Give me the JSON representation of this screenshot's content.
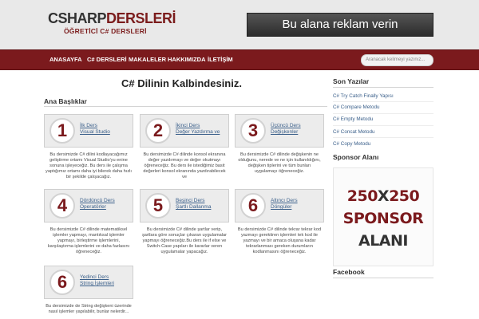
{
  "header": {
    "logo_part1": "CSHARP",
    "logo_part2": "DERSLERİ",
    "logo_sub": "ÖĞRETİCİ C# DERSLERİ",
    "ad_text": "Bu alana reklam verin"
  },
  "nav": {
    "items": [
      "ANASAYFA",
      "C# DERSLERİ",
      "MAKALELER",
      "HAKKIMIZDA",
      "İLETİŞİM"
    ],
    "search_placeholder": "Aranacak kelimeyi yazınız..."
  },
  "main": {
    "title": "C# Dilinin Kalbindesiniz.",
    "section_title": "Ana Başlıklar",
    "cards": [
      {
        "num": "1",
        "link1": "İlk Ders",
        "link2": "Visual Studio",
        "desc": "Bu dersimizde C# dilini kodlayacağımız geliştirme ortamı Visual Studio'yu enine sonuna işleyeceğiz. Bu ders ile çalışma yaptığımız ortamı daha iyi bilerek daha hızlı bir şekilde çalışacağız."
      },
      {
        "num": "2",
        "link1": "İkinci Ders",
        "link2": "Değer Yazdırma ve",
        "desc": "Bu dersimizde C# dilinde konsol ekranına değer yazdırmayı ve değer okutmayı öğreneceğiz. Bu ders ile istediğimiz basit değerleri konsol ekranında yazdırabilecek ve"
      },
      {
        "num": "3",
        "link1": "Üçüncü Ders",
        "link2": "Değişkenler",
        "desc": "Bu dersimizde C# dilinde değişkenin ne olduğunu, nerede ve ne için kullanıldığını, değişken tiplerini ve tüm bunları uygulamayı öğreneceğiz."
      },
      {
        "num": "4",
        "link1": "Dördüncü Ders",
        "link2": "Operatörler",
        "desc": "Bu dersimizde C# dilinde matematiksel işlemler yapmayı, mantıksal işlemler yapmayı, birleştirme işlemlerini, karşılaştırma işlemlerini ve daha fazlasını öğreneceğiz."
      },
      {
        "num": "5",
        "link1": "Beşinci Ders",
        "link2": "Şartlı Dallanma",
        "desc": "Bu dersimizde C# dilinde şartlar verip, şartlara göre sonuçlar çıkaran uygulamalar yapmayı öğreneceğiz.Bu ders ile if else ve Switch-Case yapıları ile kararlar veren uygulamalar yapacağız."
      },
      {
        "num": "6",
        "link1": "Altıncı Ders",
        "link2": "Döngüler",
        "desc": "Bu dersimizde C# dilinde tekrar tekrar kod yazmayı gerektiren işlemleri tek kod ile yazmayı ve bir amaca oluşana kadar tekrarlanması gereken durumların kodlanmasını öğreneceğiz."
      },
      {
        "num": "6",
        "link1": "Yedinci Ders",
        "link2": "String İşlemleri",
        "desc": "Bu dersimizde de String değişkeni üzerinde nasıl işlemler yapılabilir, bunlar nelerdir..."
      }
    ]
  },
  "sidebar": {
    "recent_title": "Son Yazılar",
    "recent_links": [
      "C# Try Catch Finally Yapısı",
      "C# Compare Metodu",
      "C# Empty Metodu",
      "C# Concat Metodu",
      "C# Copy Metodu"
    ],
    "sponsor_title": "Sponsor Alanı",
    "sponsor_l1a": "250",
    "sponsor_l1b": "X",
    "sponsor_l1c": "250",
    "sponsor_l2": "SPONSOR",
    "sponsor_l3": "ALANI",
    "facebook_title": "Facebook"
  },
  "colors": {
    "accent": "#7b1a1d",
    "header_bg": "#e9e9e9",
    "link": "#3a5f8a"
  }
}
